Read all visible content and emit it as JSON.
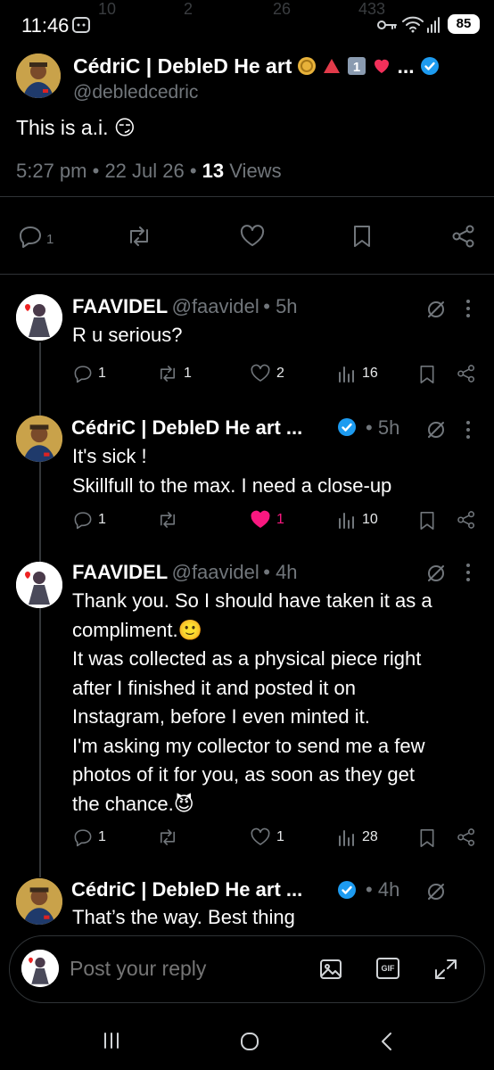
{
  "status_bar": {
    "time": "11:46",
    "battery": "85",
    "ghost_counts": [
      "10",
      "2",
      "26",
      "433"
    ]
  },
  "main_post": {
    "author_name": "CédriC | DebleD He art",
    "ellipsis": "...",
    "handle": "@debledcedric",
    "text": "This is a.i. 😏",
    "time": "5:27 pm",
    "date": "22 Jul 26",
    "views_count": "13",
    "views_label": "Views",
    "reply_count": "1"
  },
  "replies": [
    {
      "name": "FAAVIDEL",
      "handle": "@faavidel",
      "age": "5h",
      "lines": [
        "R u serious?"
      ],
      "replies": "1",
      "reposts": "1",
      "likes": "2",
      "views": "16"
    },
    {
      "name": "CédriC | DebleD He art ...",
      "age": "5h",
      "lines": [
        "It's sick !",
        "Skillfull to the max.  I need a close-up"
      ],
      "replies": "1",
      "reposts": "",
      "likes": "1",
      "views": "10",
      "liked": true
    },
    {
      "name": "FAAVIDEL",
      "handle": "@faavidel",
      "age": "4h",
      "lines": [
        "Thank you. So I should have taken it as a",
        "compliment.🙂",
        "It was collected as a physical piece right",
        "after I finished it and posted it on",
        "Instagram, before I even minted it.",
        "I'm asking my collector to send me a few",
        "photos of it for you, as soon as they get",
        "the chance.😈"
      ],
      "replies": "1",
      "reposts": "",
      "likes": "1",
      "views": "28"
    },
    {
      "name": "CédriC | DebleD He art ...",
      "age": "4h",
      "lines": [
        "That’s the way. Best thing"
      ]
    }
  ],
  "composer": {
    "placeholder": "Post your reply",
    "gif_label": "GIF"
  },
  "colors": {
    "background": "#000000",
    "text": "#e7e9ea",
    "muted": "#71767b",
    "verified": "#1d9bf0",
    "like_active": "#f91880"
  },
  "icons": [
    "reply-icon",
    "repost-icon",
    "like-icon",
    "bookmark-icon",
    "share-icon",
    "views-icon",
    "mute-icon",
    "more-icon",
    "image-icon",
    "gif-icon",
    "expand-icon",
    "verified-icon"
  ]
}
